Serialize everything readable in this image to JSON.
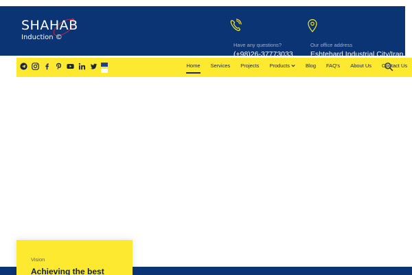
{
  "logo": {
    "main": "SHAHAB",
    "sub": "Induction ©"
  },
  "contacts": {
    "phone": {
      "label": "Have any questions?",
      "value": "(+98)26-37773033"
    },
    "office": {
      "label": "Our office address",
      "value": "Eshtehard Industrial City/Iran"
    }
  },
  "social": [
    "telegram-icon",
    "instagram-icon",
    "facebook-icon",
    "pinterest-icon",
    "youtube-icon",
    "linkedin-icon",
    "twitter-icon"
  ],
  "nav": {
    "home": "Home",
    "services": "Services",
    "projects": "Projects",
    "products": "Products",
    "blog": "Blog",
    "faqs": "FAQ's",
    "about": "About Us",
    "contact": "Contact Us"
  },
  "vision": {
    "label": "Vision",
    "title": "Achieving the best"
  },
  "colors": {
    "navy": "#0b3475",
    "yellow": "#fde92f",
    "dark_text": "#1b2540"
  }
}
